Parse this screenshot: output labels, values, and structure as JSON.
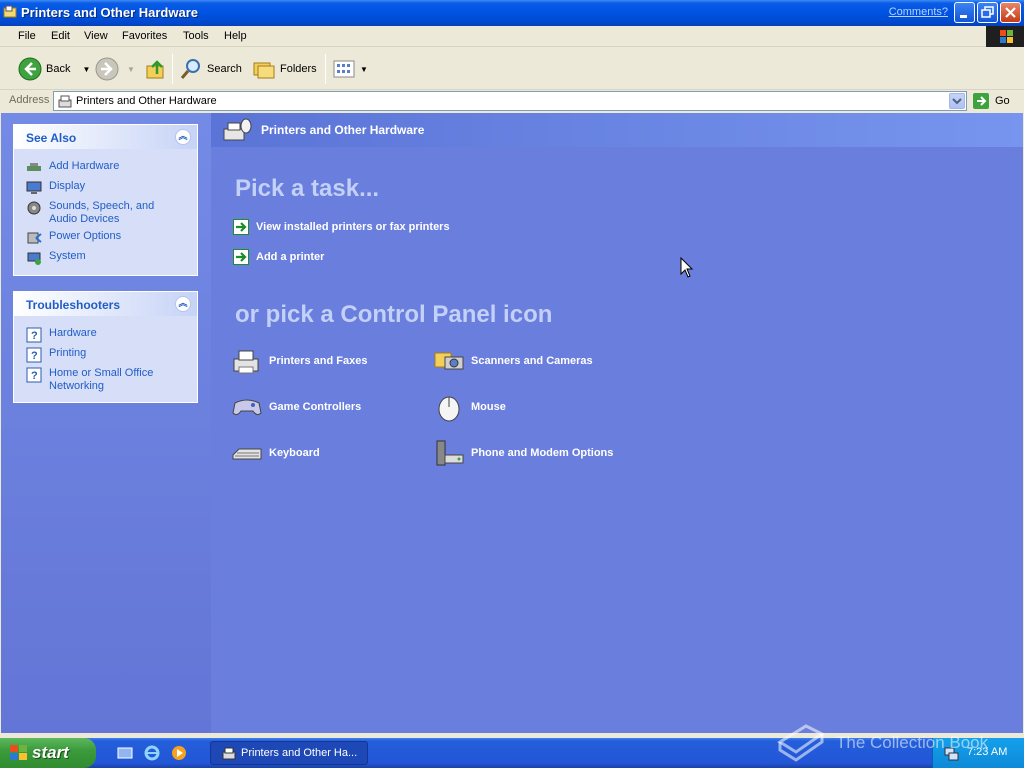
{
  "window": {
    "title": "Printers and Other Hardware",
    "comments_link": "Comments?"
  },
  "menubar": {
    "items": [
      "File",
      "Edit",
      "View",
      "Favorites",
      "Tools",
      "Help"
    ]
  },
  "toolbar": {
    "back_label": "Back",
    "search_label": "Search",
    "folders_label": "Folders"
  },
  "address": {
    "label": "Address",
    "value": "Printers and Other Hardware",
    "go_label": "Go"
  },
  "see_also": {
    "title": "See Also",
    "items": [
      {
        "label": "Add Hardware",
        "icon": "add-hardware-icon"
      },
      {
        "label": "Display",
        "icon": "display-icon"
      },
      {
        "label": "Sounds, Speech, and Audio Devices",
        "icon": "sounds-icon"
      },
      {
        "label": "Power Options",
        "icon": "power-icon"
      },
      {
        "label": "System",
        "icon": "system-icon"
      }
    ]
  },
  "troubleshooters": {
    "title": "Troubleshooters",
    "items": [
      {
        "label": "Hardware",
        "icon": "help-icon"
      },
      {
        "label": "Printing",
        "icon": "help-icon"
      },
      {
        "label": "Home or Small Office Networking",
        "icon": "help-icon"
      }
    ]
  },
  "content": {
    "header_title": "Printers and Other Hardware",
    "pick_task": "Pick a task...",
    "tasks": [
      "View installed printers or fax printers",
      "Add a printer"
    ],
    "pick_icon": "or pick a Control Panel icon",
    "icons": [
      {
        "label": "Printers and Faxes",
        "icon": "printer-icon"
      },
      {
        "label": "Scanners and Cameras",
        "icon": "scanner-camera-icon"
      },
      {
        "label": "Game Controllers",
        "icon": "gamepad-icon"
      },
      {
        "label": "Mouse",
        "icon": "mouse-icon"
      },
      {
        "label": "Keyboard",
        "icon": "keyboard-icon"
      },
      {
        "label": "Phone and Modem Options",
        "icon": "phone-modem-icon"
      }
    ]
  },
  "taskbar": {
    "start_label": "start",
    "task_button": "Printers and Other Ha...",
    "clock": "7:23 AM"
  },
  "watermark": "The Collection Book",
  "colors": {
    "title_blue": "#0054e3",
    "content_bg": "#6a7edd",
    "panel_bg": "#d6dff7",
    "link_blue": "#215dc6",
    "start_green": "#3c9b3c"
  }
}
